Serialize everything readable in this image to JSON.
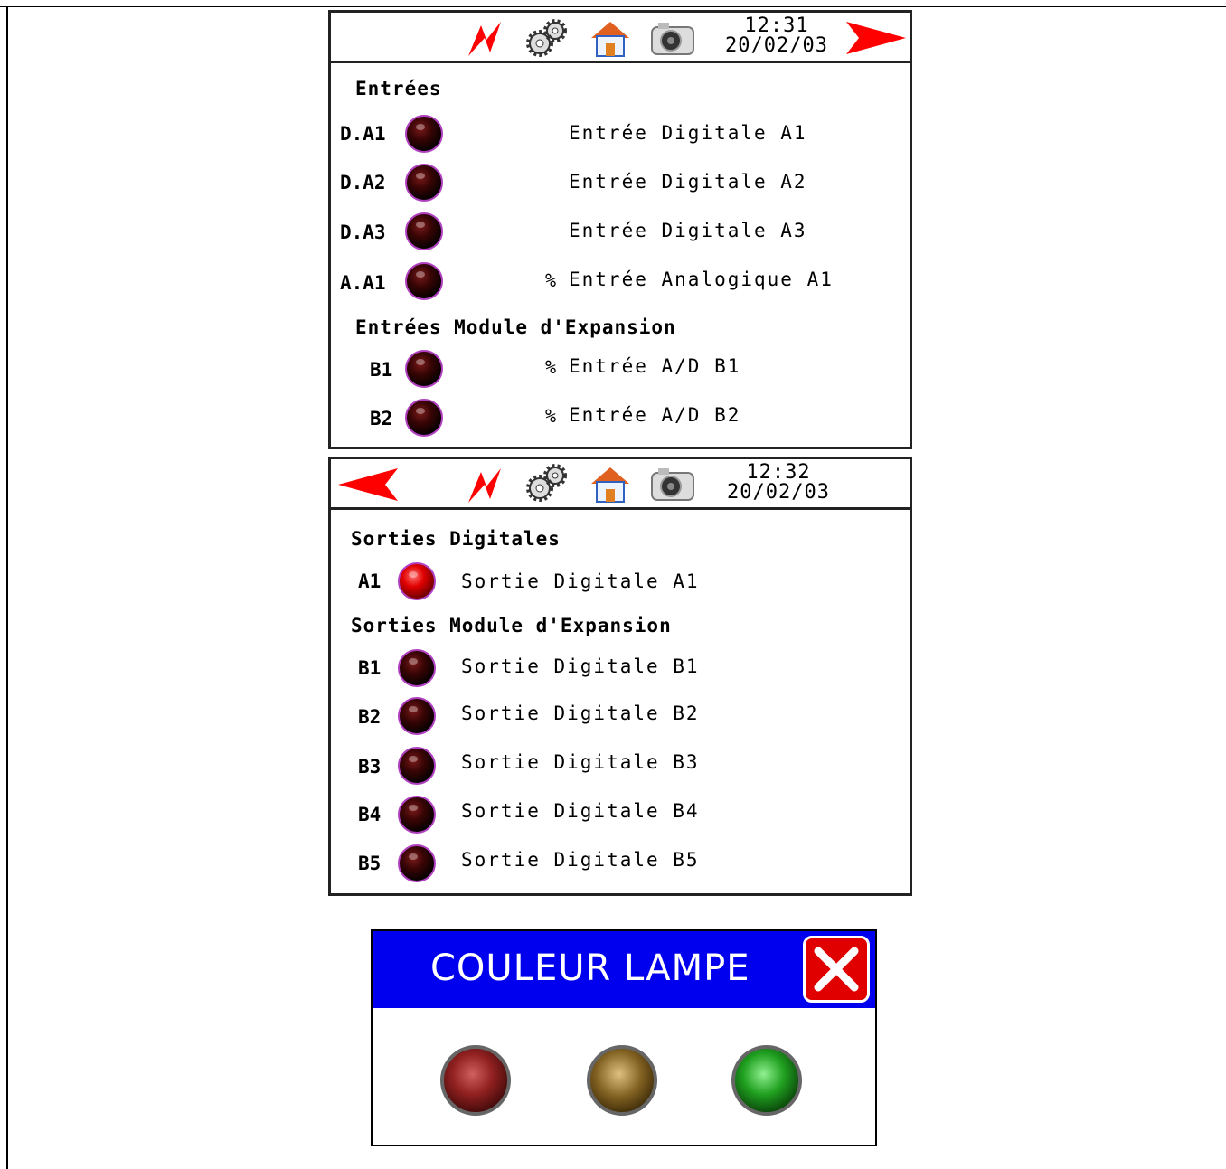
{
  "screen1": {
    "time": "12:31",
    "date": "20/02/03",
    "heading": "Entrées",
    "rows": [
      {
        "code": "D.A1",
        "pct": "",
        "label": "Entrée Digitale A1"
      },
      {
        "code": "D.A2",
        "pct": "",
        "label": "Entrée Digitale A2"
      },
      {
        "code": "D.A3",
        "pct": "",
        "label": "Entrée Digitale A3"
      },
      {
        "code": "A.A1",
        "pct": "%",
        "label": "Entrée Analogique A1"
      }
    ],
    "expansion_heading": "Entrées Module d'Expansion",
    "expansion_rows": [
      {
        "code": "B1",
        "pct": "%",
        "label": "Entrée A/D B1"
      },
      {
        "code": "B2",
        "pct": "%",
        "label": "Entrée A/D B2"
      }
    ]
  },
  "screen2": {
    "time": "12:32",
    "date": "20/02/03",
    "heading": "Sorties Digitales",
    "rows": [
      {
        "code": "A1",
        "label": "Sortie Digitale A1",
        "state": "on"
      }
    ],
    "expansion_heading": "Sorties Module d'Expansion",
    "expansion_rows": [
      {
        "code": "B1",
        "label": "Sortie Digitale B1",
        "state": "off"
      },
      {
        "code": "B2",
        "label": "Sortie Digitale B2",
        "state": "off"
      },
      {
        "code": "B3",
        "label": "Sortie Digitale B3",
        "state": "off"
      },
      {
        "code": "B4",
        "label": "Sortie Digitale B4",
        "state": "off"
      },
      {
        "code": "B5",
        "label": "Sortie Digitale B5",
        "state": "off"
      }
    ]
  },
  "dialog": {
    "title": "COULEUR LAMPE",
    "lamps": [
      "red",
      "amber",
      "green"
    ]
  },
  "icons": [
    "lightning-icon",
    "gears-icon",
    "home-icon",
    "camera-icon",
    "arrow-right-icon",
    "arrow-left-icon",
    "close-icon"
  ],
  "colors": {
    "accent_red": "#ff0000",
    "dialog_blue": "#0000ee"
  }
}
